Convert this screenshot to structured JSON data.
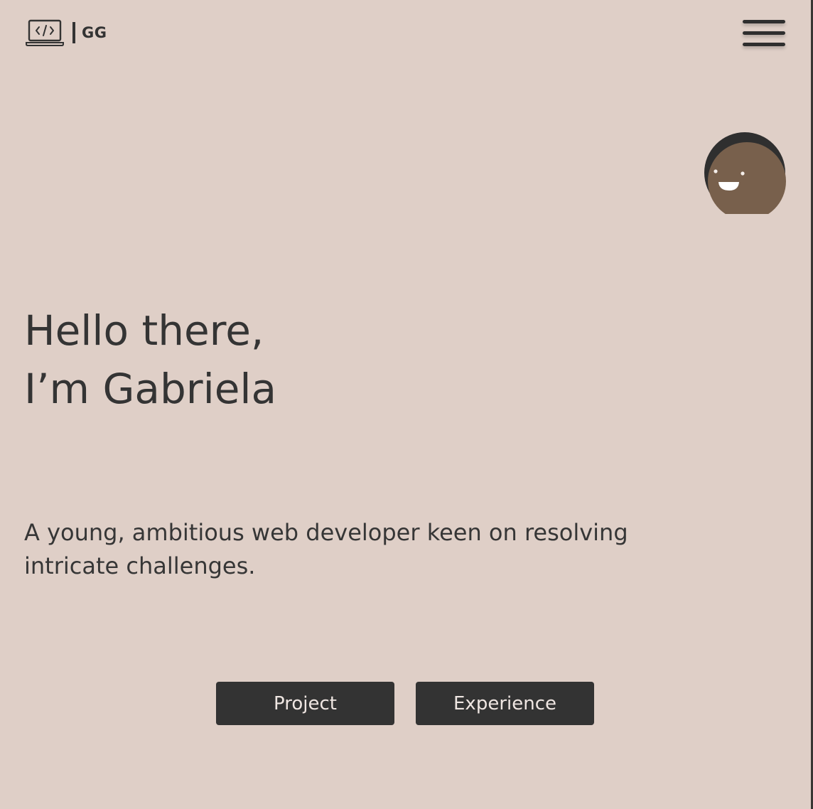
{
  "header": {
    "logo_text": "GG",
    "logo_icon": "laptop-code-icon",
    "menu_icon": "hamburger-menu-icon"
  },
  "avatar": {
    "icon": "smiling-face-avatar"
  },
  "hero": {
    "greeting_line1": "Hello there,",
    "greeting_line2": "I’m Gabriela",
    "tagline": "A young, ambitious web developer keen on resolving intricate challenges."
  },
  "buttons": {
    "project_label": "Project",
    "experience_label": "Experience"
  },
  "colors": {
    "background": "#dfcfc7",
    "text": "#333333",
    "button_bg": "#333333",
    "button_text": "#efe6e2",
    "avatar_skin": "#78604c",
    "avatar_hair": "#2f2f2f"
  }
}
